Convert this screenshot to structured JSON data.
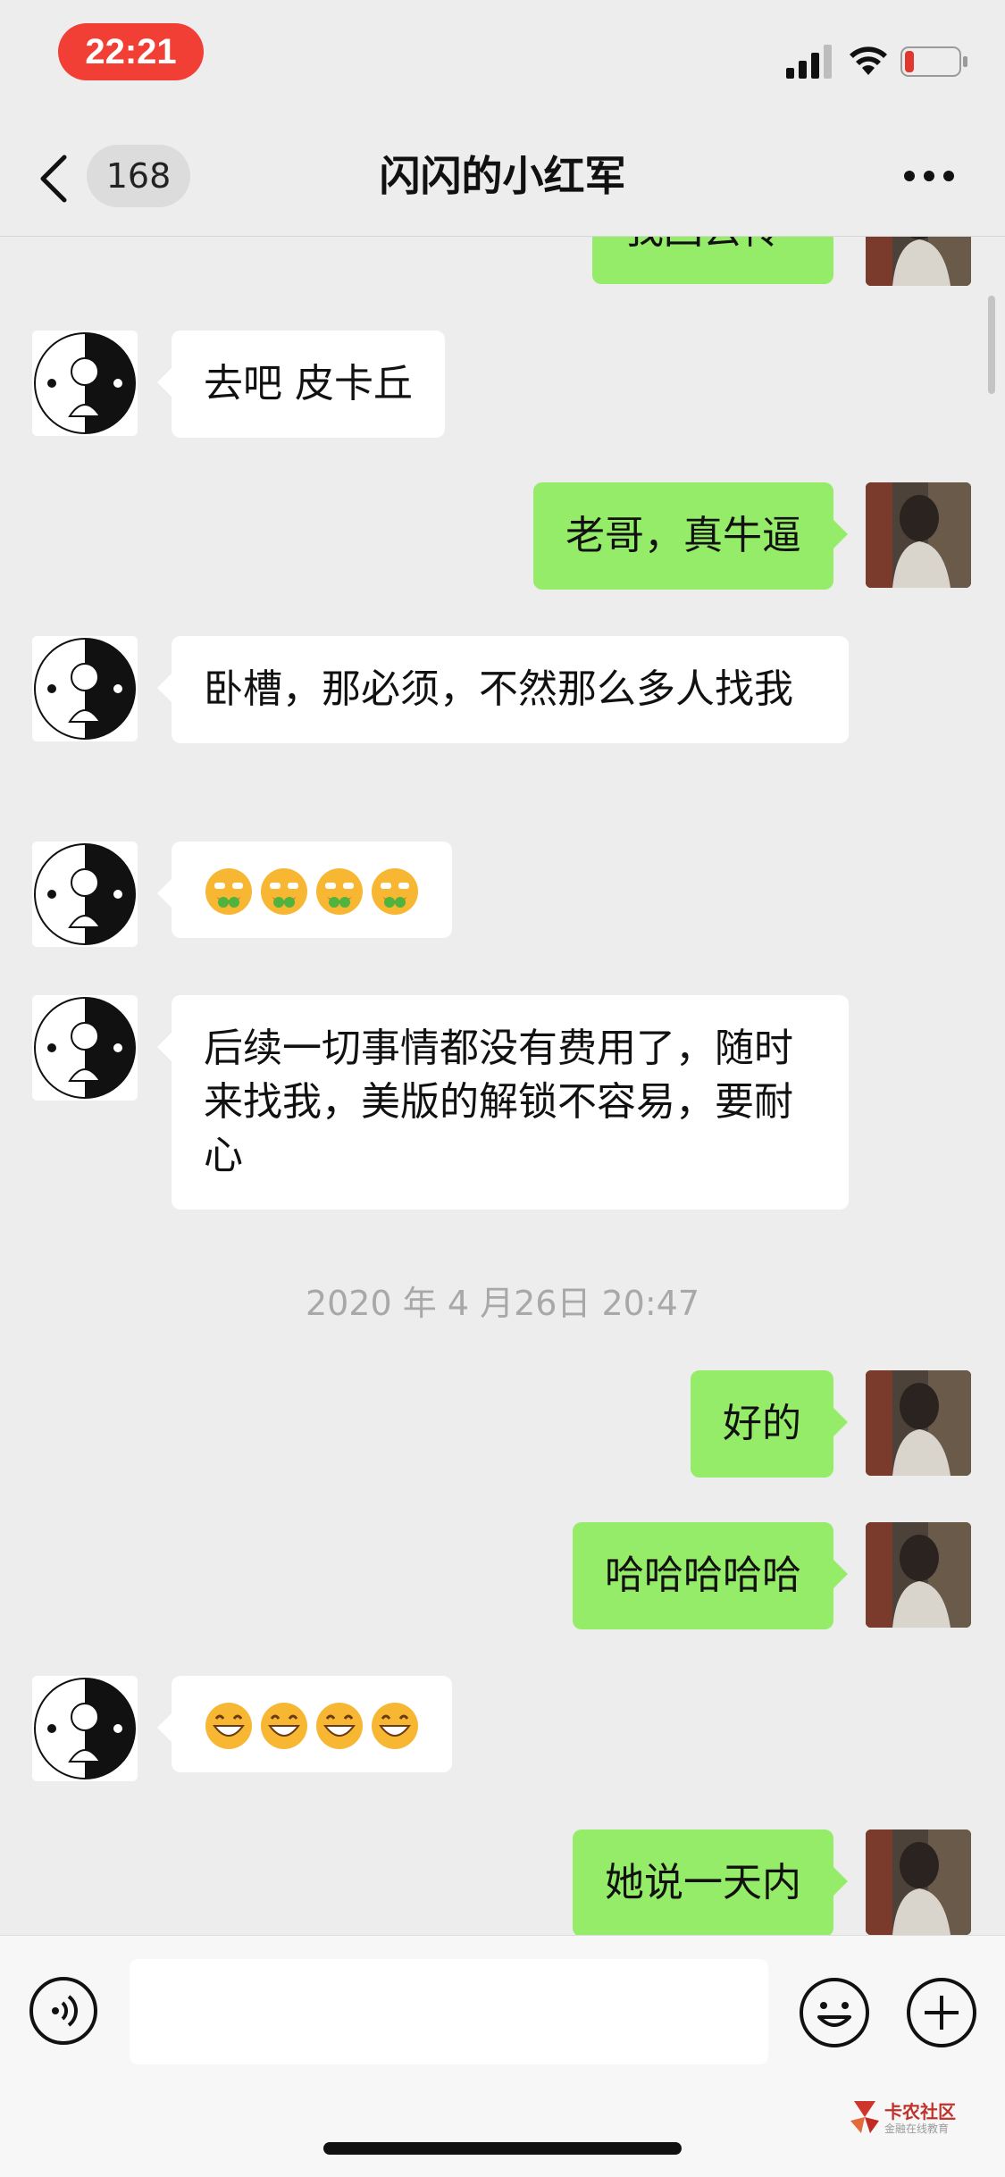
{
  "status_bar": {
    "time": "22:21"
  },
  "nav": {
    "back_count": "168",
    "title": "闪闪的小红军"
  },
  "messages": [
    {
      "side": "right",
      "text": "我回去传"
    },
    {
      "side": "left",
      "text": "去吧 皮卡丘"
    },
    {
      "side": "right",
      "text": "老哥，真牛逼"
    },
    {
      "side": "left",
      "text": "卧槽，那必须，不然那么多人找我"
    },
    {
      "side": "left",
      "emoji": "drooling-face",
      "count": 4
    },
    {
      "side": "left",
      "text": "后续一切事情都没有费用了，随时来找我，美版的解锁不容易，要耐心"
    },
    {
      "timestamp": "2020 年 4 月26日 20:47"
    },
    {
      "side": "right",
      "text": "好的"
    },
    {
      "side": "right",
      "text": "哈哈哈哈哈"
    },
    {
      "side": "left",
      "emoji": "grinning-face",
      "count": 4
    },
    {
      "side": "right",
      "text": "她说一天内"
    }
  ],
  "input": {
    "value": "",
    "placeholder": ""
  },
  "watermark": {
    "name": "卡农社区",
    "sub": "金融在线教育"
  },
  "colors": {
    "outgoing_bubble": "#95ec69",
    "incoming_bubble": "#ffffff",
    "background": "#ededed",
    "time_pill": "#f23f35"
  },
  "icons": [
    "signal-icon",
    "wifi-icon",
    "battery-icon",
    "back-chevron-icon",
    "more-icon",
    "voice-icon",
    "emoji-icon",
    "plus-icon"
  ]
}
